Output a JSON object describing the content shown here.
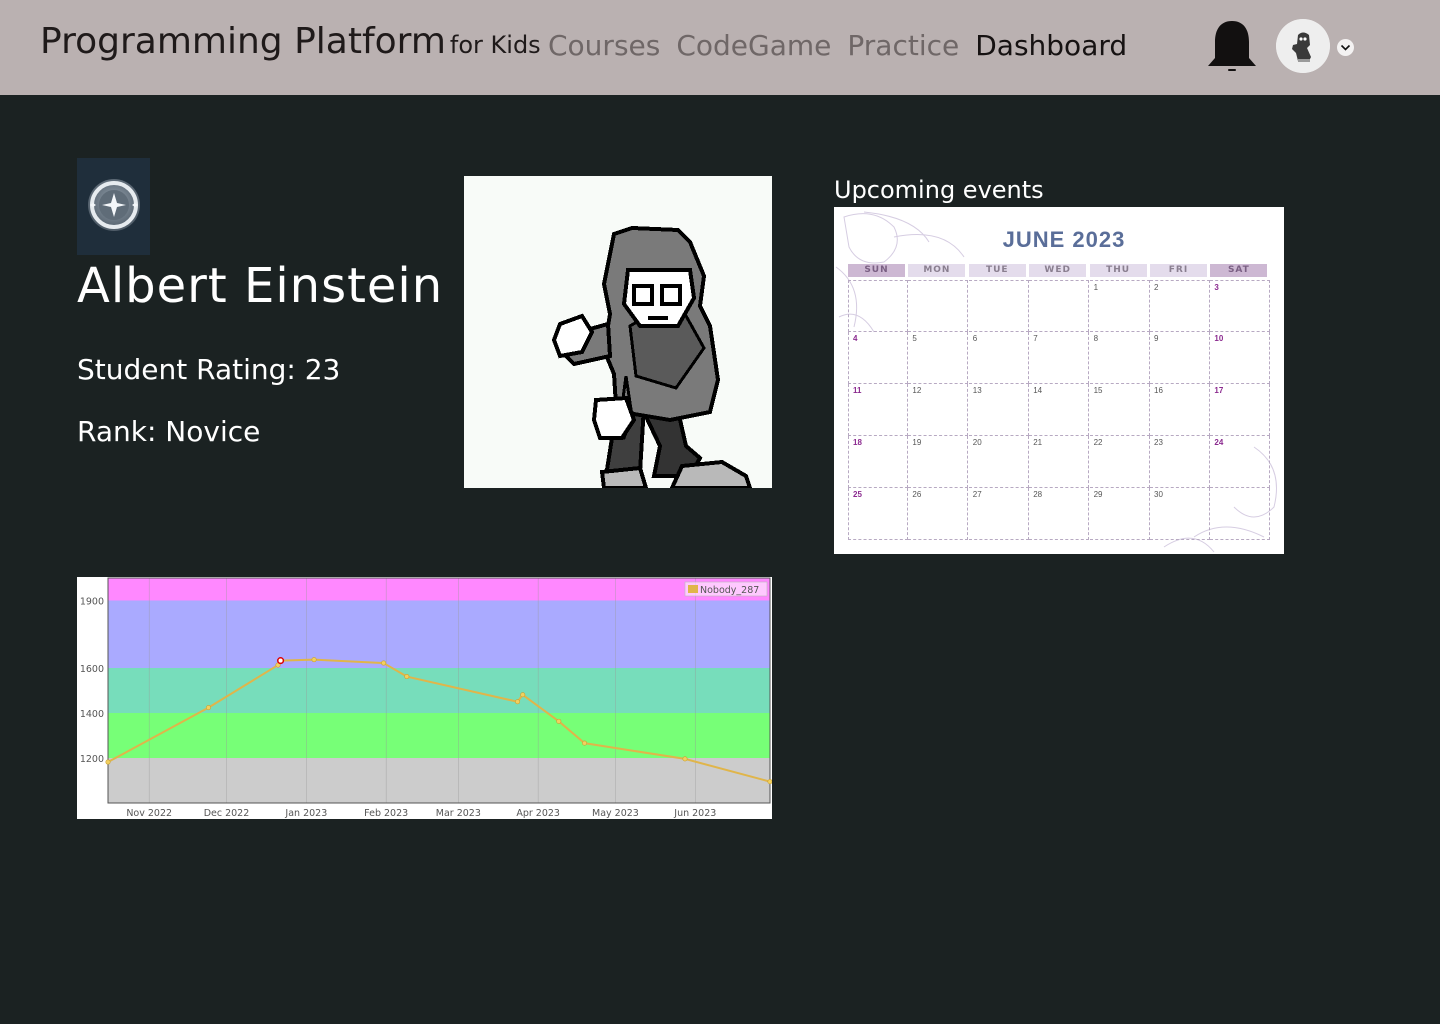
{
  "header": {
    "brand_main": "Programming Platform",
    "brand_sub": "for Kids",
    "nav": [
      {
        "label": "Courses",
        "active": false
      },
      {
        "label": "CodeGame",
        "active": false
      },
      {
        "label": "Practice",
        "active": false
      },
      {
        "label": "Dashboard",
        "active": true
      }
    ],
    "notification_icon": "bell-icon",
    "avatar_icon": "avatar-icon",
    "dropdown_icon": "chevron-down-icon"
  },
  "profile": {
    "name": "Albert Einstein",
    "rating_text": "Student Rating: 23",
    "rank_text": "Rank: Novice",
    "badge_icon": "rank-badge-icon",
    "character_icon": "hooded-character-icon"
  },
  "events": {
    "label": "Upcoming events",
    "calendar": {
      "title": "JUNE 2023",
      "weekdays": [
        "SUN",
        "MON",
        "TUE",
        "WED",
        "THU",
        "FRI",
        "SAT"
      ],
      "start_weekday": 4,
      "days_in_month": 30
    }
  },
  "colors": {
    "page_bg": "#1b2222",
    "header_bg": "#bab1b1",
    "calendar_title": "#5a6e99",
    "weekend_text": "#8b2a8f",
    "line_color": "#e0b54a"
  },
  "chart_data": {
    "type": "line",
    "title": "",
    "xlabel": "",
    "ylabel": "",
    "ylim": [
      1000,
      2000
    ],
    "yticks": [
      1200,
      1400,
      1600,
      1900
    ],
    "x_ticks": [
      "Nov 2022",
      "Dec 2022",
      "Jan 2023",
      "Feb 2023",
      "Mar 2023",
      "Apr 2023",
      "May 2023",
      "Jun 2023"
    ],
    "grid": true,
    "legend": {
      "position": "top-right"
    },
    "bands": [
      {
        "from": 1000,
        "to": 1200,
        "color": "#cccccc"
      },
      {
        "from": 1200,
        "to": 1400,
        "color": "#77ff77"
      },
      {
        "from": 1400,
        "to": 1600,
        "color": "#77ddbb"
      },
      {
        "from": 1600,
        "to": 1900,
        "color": "#aaaaff"
      },
      {
        "from": 1900,
        "to": 2000,
        "color": "#ff88ff"
      }
    ],
    "series": [
      {
        "name": "Nobody_287",
        "points": [
          {
            "x": "2022-10-16",
            "y": 1182
          },
          {
            "x": "2022-11-24",
            "y": 1424
          },
          {
            "x": "2022-12-21",
            "y": 1613
          },
          {
            "x": "2022-12-22",
            "y": 1633
          },
          {
            "x": "2023-01-04",
            "y": 1637
          },
          {
            "x": "2023-01-31",
            "y": 1622
          },
          {
            "x": "2023-02-09",
            "y": 1562
          },
          {
            "x": "2023-03-24",
            "y": 1450
          },
          {
            "x": "2023-03-26",
            "y": 1481
          },
          {
            "x": "2023-04-09",
            "y": 1363
          },
          {
            "x": "2023-04-19",
            "y": 1266
          },
          {
            "x": "2023-05-28",
            "y": 1196
          },
          {
            "x": "2023-06-30",
            "y": 1095
          }
        ]
      }
    ],
    "highlight_index": 2
  }
}
